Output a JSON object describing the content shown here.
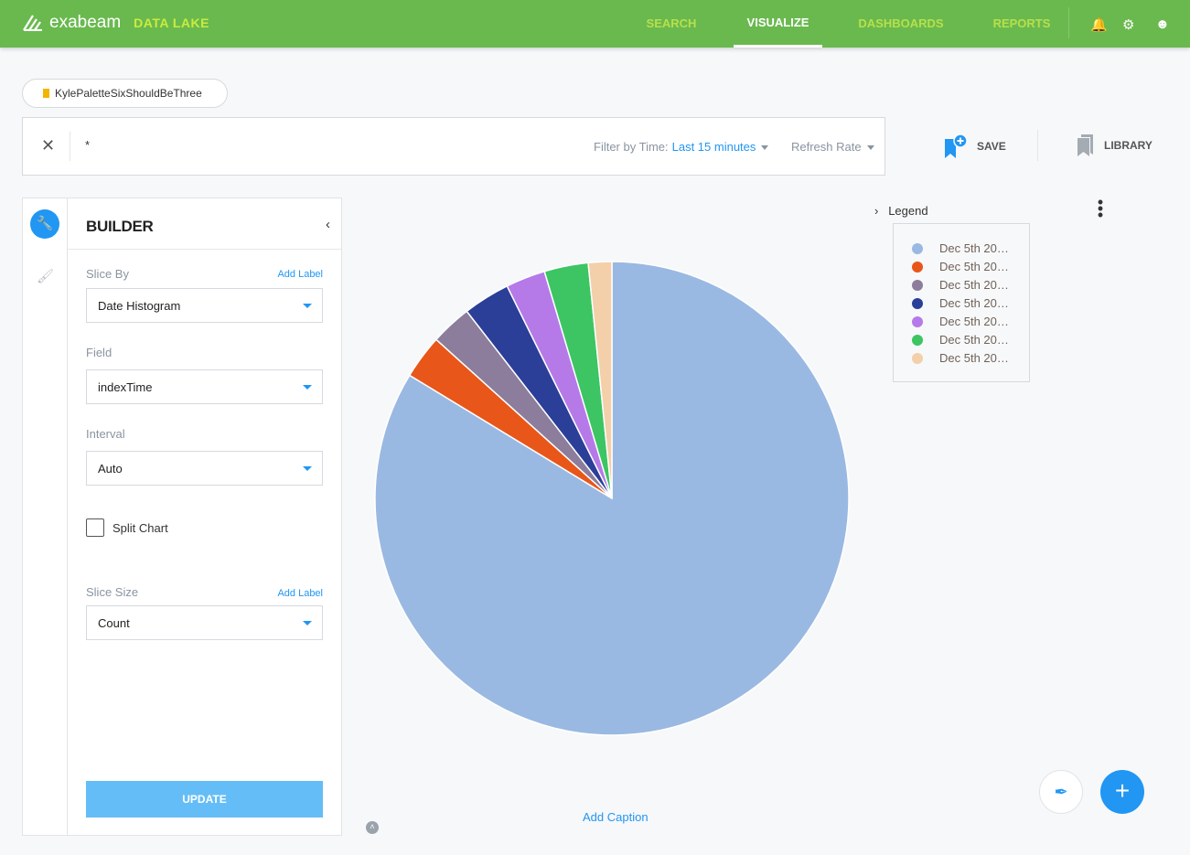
{
  "header": {
    "brand": "exabeam",
    "product": "DATA LAKE",
    "nav": [
      "SEARCH",
      "VISUALIZE",
      "DASHBOARDS",
      "REPORTS"
    ],
    "active_nav": "VISUALIZE"
  },
  "saved_search": {
    "name": "KylePaletteSixShouldBeThree"
  },
  "search": {
    "query": "*",
    "filter_label": "Filter by Time:",
    "filter_value": "Last 15 minutes",
    "refresh_label": "Refresh Rate"
  },
  "actions": {
    "save": "SAVE",
    "library": "LIBRARY"
  },
  "builder": {
    "title": "BUILDER",
    "slice_by_label": "Slice By",
    "add_label": "Add Label",
    "slice_by_value": "Date Histogram",
    "field_label": "Field",
    "field_value": "indexTime",
    "interval_label": "Interval",
    "interval_value": "Auto",
    "split_chart_label": "Split Chart",
    "split_chart_checked": false,
    "slice_size_label": "Slice Size",
    "slice_size_value": "Count",
    "update": "UPDATE"
  },
  "chart_data": {
    "type": "pie",
    "legend_title": "Legend",
    "legend_position": "right",
    "categories": [
      "Dec 5th 20…",
      "Dec 5th 20…",
      "Dec 5th 20…",
      "Dec 5th 20…",
      "Dec 5th 20…",
      "Dec 5th 20…",
      "Dec 5th 20…"
    ],
    "values": [
      83.7,
      3.0,
      2.8,
      3.2,
      2.7,
      3.0,
      1.6
    ],
    "colors": [
      "#9ab9e2",
      "#e8561a",
      "#8b7d9b",
      "#2b3f98",
      "#b57ae8",
      "#3cc562",
      "#f3cfaa"
    ]
  },
  "caption": "Add Caption"
}
